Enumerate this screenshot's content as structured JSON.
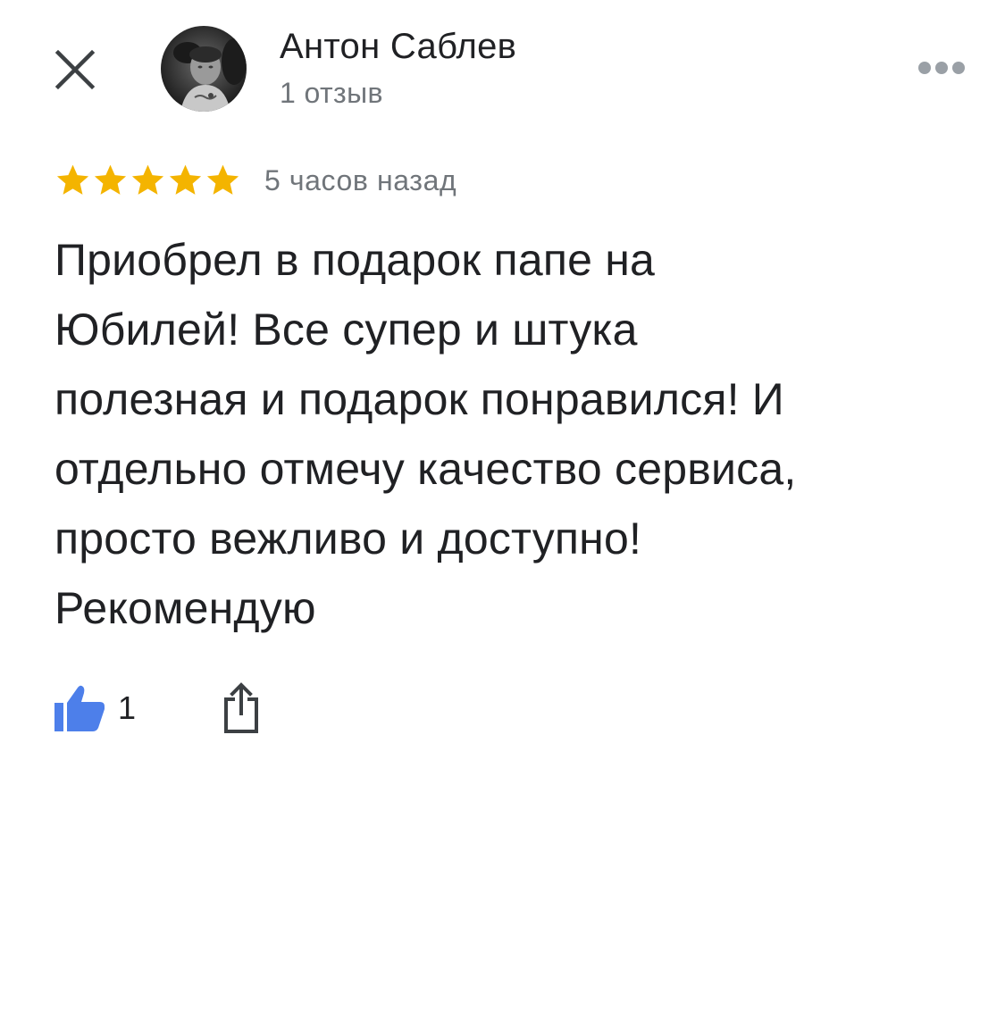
{
  "header": {
    "close_icon": "close-icon",
    "avatar_icon": "user-avatar",
    "more_icon": "more-horizontal-icon"
  },
  "author": {
    "name": "Антон Саблев",
    "reviews_count": "1 отзыв"
  },
  "review": {
    "rating": 5,
    "rating_max": 5,
    "time": "5 часов назад",
    "text_lines": [
      "Приобрел в подарок папе на",
      "Юбилей! Все супер и штука",
      "полезная и подарок понравился! И",
      "отдельно отмечу качество сервиса,",
      "просто вежливо и доступно!",
      "Рекомендую"
    ]
  },
  "actions": {
    "like_count": "1",
    "like_icon": "thumbs-up-icon",
    "share_icon": "share-icon"
  },
  "colors": {
    "star": "#f4b400",
    "like": "#4d7fea",
    "text_primary": "#202124",
    "text_secondary": "#70757a"
  }
}
